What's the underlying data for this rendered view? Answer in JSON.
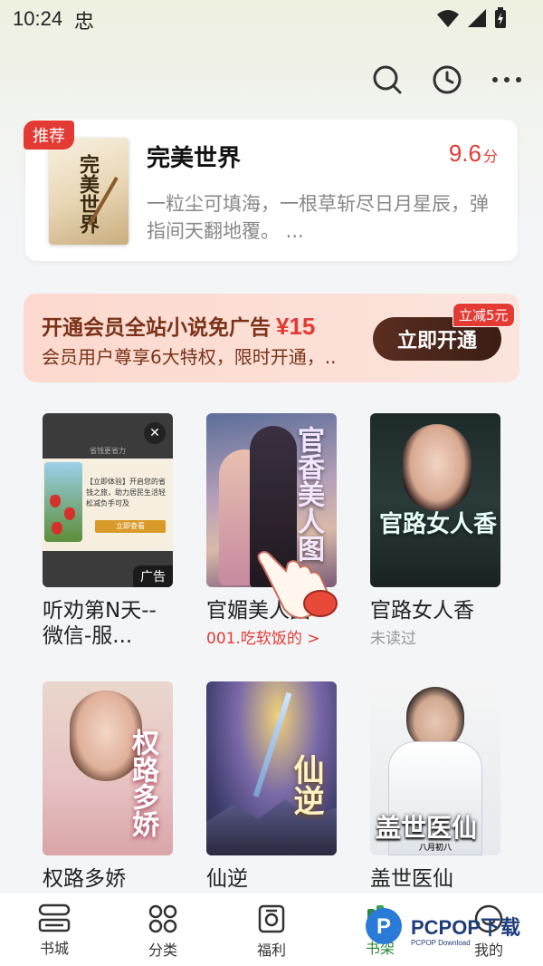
{
  "status_bar": {
    "time": "10:24",
    "app_glyph": "忠"
  },
  "top_actions": [
    {
      "icon": "search-icon"
    },
    {
      "icon": "history-clock-icon"
    },
    {
      "icon": "more-dots-icon"
    }
  ],
  "recommend": {
    "tag": "推荐",
    "cover_title": "完美世界",
    "title": "完美世界",
    "score": "9.6",
    "score_unit": "分",
    "description": "一粒尘可填海，一根草斩尽日月星辰，弹指间天翻地覆。 ..."
  },
  "vip": {
    "title": "开通会员全站小说免广告",
    "price": "¥15",
    "subtitle": "会员用户尊享6大特权，限时开通，..",
    "button": "立即开通",
    "badge": "立减5元"
  },
  "books": [
    {
      "name": "听劝第N天--微信-服...",
      "meta": "",
      "is_ad": true,
      "ad_label": "广告",
      "ad_top": "省钱更省力",
      "ad_text": "【立即体验】开启您的省钱之旅，助力居民生活轻松减负手可及",
      "ad_button": "立即查看"
    },
    {
      "name": "官媚美人图",
      "meta": "001.吃软饭的 >",
      "meta_style": "red",
      "cover_title": "官香美人图"
    },
    {
      "name": "官路女人香",
      "meta": "未读过",
      "meta_style": "gray",
      "cover_title": "官路女人香"
    },
    {
      "name": "权路多娇",
      "meta": "",
      "cover_title": "权路多娇"
    },
    {
      "name": "仙逆",
      "meta": "",
      "cover_title": "仙逆"
    },
    {
      "name": "盖世医仙",
      "meta": "",
      "cover_title": "盖世医仙",
      "cover_sub": "八月初八"
    }
  ],
  "bottom_nav": [
    {
      "label": "书城",
      "icon": "bookshelf-icon"
    },
    {
      "label": "分类",
      "icon": "category-grid-icon"
    },
    {
      "label": "福利",
      "icon": "gift-bag-icon"
    },
    {
      "label": "书架",
      "icon": "bookcase-icon",
      "active": true
    },
    {
      "label": "我的",
      "icon": "profile-icon"
    }
  ],
  "watermark": {
    "text": "PCPOP下载",
    "sub": "PCPOP Download"
  },
  "colors": {
    "accent_red": "#e43a34",
    "vip_button": "#4a2519",
    "vip_bg": "#fdd9cf",
    "nav_active": "#2a8a3a"
  }
}
